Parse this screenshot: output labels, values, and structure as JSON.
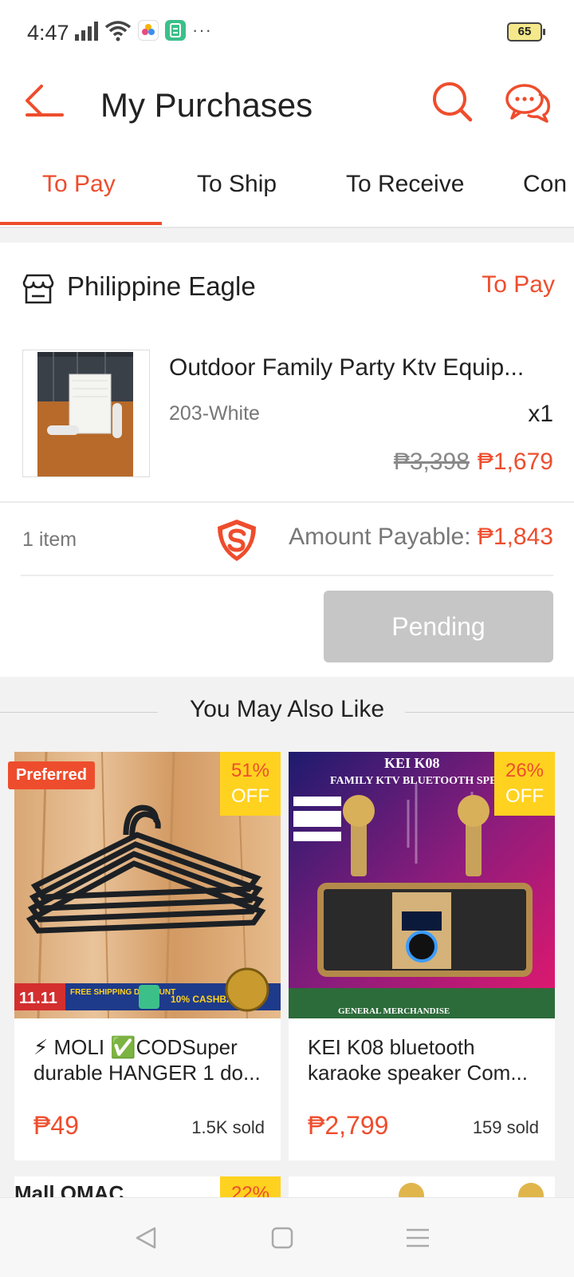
{
  "status_bar": {
    "time": "4:47",
    "battery": "65"
  },
  "header": {
    "title": "My Purchases"
  },
  "tabs": [
    {
      "label": "To Pay",
      "active": true
    },
    {
      "label": "To Ship",
      "active": false
    },
    {
      "label": "To Receive",
      "active": false
    },
    {
      "label": "Con",
      "active": false
    }
  ],
  "order": {
    "shop_name": "Philippine Eagle",
    "status": "To Pay",
    "product": {
      "name": "Outdoor Family Party Ktv Equip...",
      "variant": "203-White",
      "quantity": "x1",
      "original_price": "₱3,398",
      "price": "₱1,679"
    },
    "item_count": "1 item",
    "amount_label": "Amount Payable: ",
    "amount_value": "₱1,843",
    "action_label": "Pending"
  },
  "recommendations": {
    "title": "You May Also Like",
    "items": [
      {
        "name": "⚡ MOLI ✅CODSuper durable HANGER 1 do...",
        "price": "₱49",
        "sold": "1.5K sold",
        "discount_pct": "51%",
        "discount_off": "OFF",
        "badge": "Preferred",
        "image_text": {
          "promo": "11.11",
          "free_ship": "FREE SHIPPING DISCOUNT",
          "cashback": "10% CASHBACK"
        }
      },
      {
        "name": "KEI K08 bluetooth karaoke speaker Com...",
        "price": "₱2,799",
        "sold": "159 sold",
        "discount_pct": "26%",
        "discount_off": "OFF",
        "image_text": {
          "brand": "KEI K08",
          "subtitle": "FAMILY KTV BLUETOOTH SPEA",
          "footer": "GENERAL MERCHANDISE"
        }
      }
    ],
    "next_row": [
      {
        "discount_pct": "22%",
        "logo": "Mall OMAC"
      }
    ]
  },
  "colors": {
    "accent": "#ee4d2d",
    "badge": "#ffd21f",
    "button_disabled": "#c6c6c6"
  }
}
